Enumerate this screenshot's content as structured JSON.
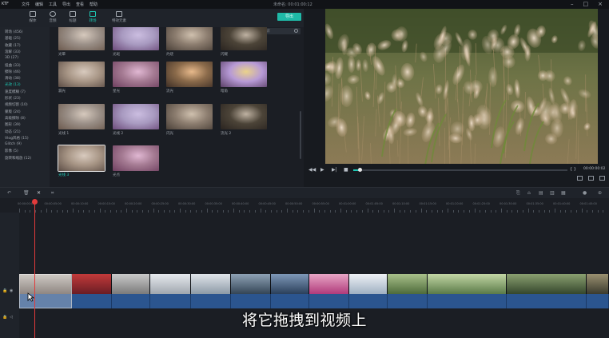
{
  "app": {
    "logo": "KTF",
    "title": "未命名: 00:01:00:12"
  },
  "menu": [
    "文件",
    "编辑",
    "工具",
    "导出",
    "查看",
    "帮助"
  ],
  "toolbar": {
    "tabs": [
      {
        "label": "媒体",
        "icon": "folder-icon",
        "active": false
      },
      {
        "label": "音频",
        "icon": "music-icon",
        "active": false
      },
      {
        "label": "标题",
        "icon": "title-icon",
        "active": false
      },
      {
        "label": "转场",
        "icon": "transition-icon",
        "active": true
      },
      {
        "label": "特效元素",
        "icon": "effects-icon",
        "active": false
      }
    ],
    "export_label": "导出"
  },
  "categories": [
    {
      "label": "转场 (456)",
      "active": false
    },
    {
      "label": "基础 (25)",
      "active": false
    },
    {
      "label": "收藏 (17)",
      "active": false
    },
    {
      "label": "溶解 (33)",
      "active": false
    },
    {
      "label": "3D (27)",
      "active": false
    },
    {
      "label": "扭曲 (33)",
      "active": false
    },
    {
      "label": "擦除 (46)",
      "active": false
    },
    {
      "label": "滑动 (38)",
      "active": false
    },
    {
      "label": "光效 (13)",
      "active": true
    },
    {
      "label": "速度模糊 (7)",
      "active": false
    },
    {
      "label": "形状 (23)",
      "active": false
    },
    {
      "label": "视频切割 (10)",
      "active": false
    },
    {
      "label": "蒙版 (24)",
      "active": false
    },
    {
      "label": "高级擦除 (8)",
      "active": false
    },
    {
      "label": "图形 (39)",
      "active": false
    },
    {
      "label": "动态 (21)",
      "active": false
    },
    {
      "label": "Vlog风格 (15)",
      "active": false
    },
    {
      "label": "Glitch (9)",
      "active": false
    },
    {
      "label": "影像 (5)",
      "active": false
    },
    {
      "label": "旋转和缩放 (12)",
      "active": false
    }
  ],
  "search": {
    "placeholder": "搜索"
  },
  "library_rows": [
    [
      "光晕",
      "光斑",
      "灼烧",
      "闪耀"
    ],
    [
      "漏光",
      "星光",
      "流光",
      "暗角"
    ],
    [
      "光线 1",
      "光线 2",
      "闪光",
      "流光 2"
    ],
    [
      "光线 3",
      "光点"
    ]
  ],
  "player": {
    "timecode": "00:00:00:02",
    "progress": 0.03,
    "buttons": [
      "prev-frame",
      "play",
      "next-frame",
      "stop"
    ]
  },
  "ruler_labels": [
    "00:00:00:00",
    "00:00:05:00",
    "00:00:10:00",
    "00:00:15:00",
    "00:00:20:00",
    "00:00:25:00",
    "00:00:30:00",
    "00:00:35:00",
    "00:00:40:00",
    "00:00:45:00",
    "00:00:50:00",
    "00:00:55:00",
    "00:01:00:00",
    "00:01:05:00",
    "00:01:10:00",
    "00:01:15:00",
    "00:01:20:00",
    "00:01:25:00",
    "00:01:30:00",
    "00:01:35:00",
    "00:01:40:00",
    "00:01:45:00"
  ],
  "subtitle": "将它拖拽到视频上",
  "colors": {
    "accent": "#1ec8b4",
    "playhead": "#e23b3b",
    "audio": "#2b558f"
  }
}
